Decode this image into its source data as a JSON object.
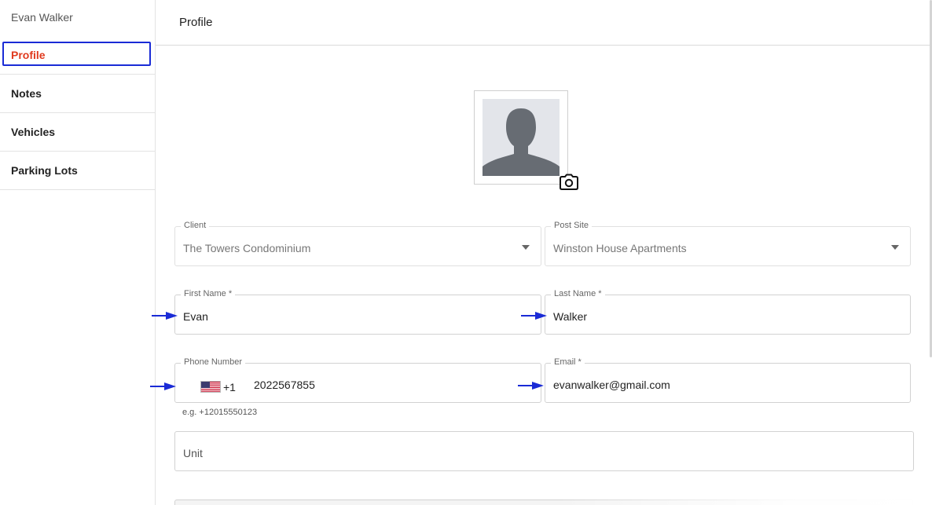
{
  "sidebar": {
    "user_name": "Evan Walker",
    "items": [
      {
        "label": "Profile",
        "active": true
      },
      {
        "label": "Notes",
        "active": false
      },
      {
        "label": "Vehicles",
        "active": false
      },
      {
        "label": "Parking Lots",
        "active": false
      }
    ]
  },
  "header": {
    "title": "Profile"
  },
  "avatar": {
    "icon": "user-placeholder-icon",
    "upload_icon": "camera-icon"
  },
  "form": {
    "client": {
      "label": "Client",
      "value": "The Towers Condominium"
    },
    "post_site": {
      "label": "Post Site",
      "value": "Winston House Apartments"
    },
    "first_name": {
      "label": "First Name *",
      "value": "Evan"
    },
    "last_name": {
      "label": "Last Name *",
      "value": "Walker"
    },
    "phone": {
      "label": "Phone Number",
      "country_code": "+1",
      "value": "2022567855",
      "helper": "e.g. +12015550123",
      "flag_icon": "us-flag-icon"
    },
    "email": {
      "label": "Email *",
      "value": "evanwalker@gmail.com"
    },
    "unit": {
      "placeholder": "Unit"
    }
  },
  "colors": {
    "active_nav": "#e03a1e",
    "highlight_box": "#1a2bd6",
    "arrow": "#1a2bd6"
  }
}
